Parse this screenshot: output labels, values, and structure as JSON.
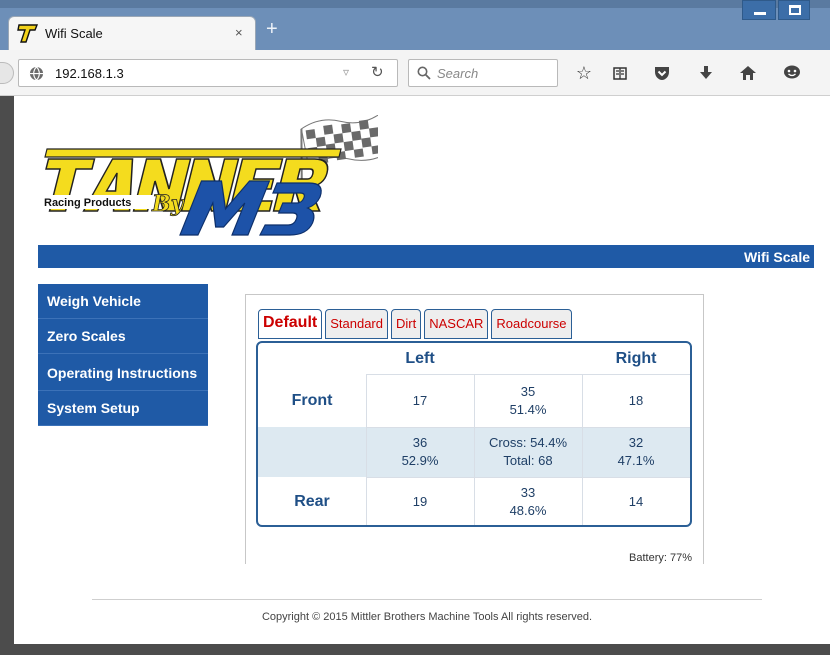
{
  "browser": {
    "tab_title": "Wifi Scale",
    "tab_close": "×",
    "new_tab": "+",
    "url": "192.168.1.3",
    "search_placeholder": "Search",
    "icons": [
      "star-icon",
      "reading-list-icon",
      "pocket-icon",
      "download-icon",
      "home-icon",
      "chat-icon"
    ]
  },
  "header": {
    "title": "Wifi Scale"
  },
  "sidebar": {
    "items": [
      {
        "label": "Weigh Vehicle"
      },
      {
        "label": "Zero Scales"
      },
      {
        "label": "Operating Instructions"
      },
      {
        "label": "System Setup"
      }
    ]
  },
  "tabs": {
    "items": [
      {
        "label": "Default",
        "active": true
      },
      {
        "label": "Standard"
      },
      {
        "label": "Dirt"
      },
      {
        "label": "NASCAR"
      },
      {
        "label": "Roadcourse"
      }
    ]
  },
  "scale": {
    "col_left": "Left",
    "col_right": "Right",
    "row_front": "Front",
    "row_rear": "Rear",
    "front_left": "17",
    "front_total": "35",
    "front_pct": "51.4%",
    "front_right": "18",
    "left_total": "36",
    "left_pct": "52.9%",
    "cross": "Cross: 54.4%",
    "total": "Total: 68",
    "right_total": "32",
    "right_pct": "47.1%",
    "rear_left": "19",
    "rear_total": "33",
    "rear_pct": "48.6%",
    "rear_right": "14"
  },
  "battery": "Battery: 77%",
  "footer": {
    "copyright": "Copyright © 2015 Mittler Brothers Machine Tools All rights reserved."
  },
  "colors": {
    "nav_blue": "#1f5aa6",
    "tab_red": "#cc0000",
    "grid_border": "#2b5f96",
    "band": "#dde9f1"
  }
}
